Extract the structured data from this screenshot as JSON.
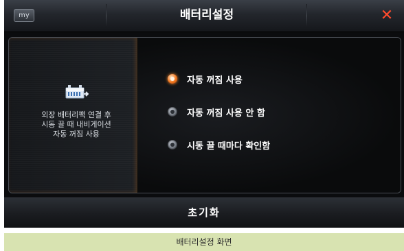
{
  "header": {
    "my_label": "my",
    "title": "배터리설정",
    "close_icon": "close-icon",
    "close_symbol": "✕"
  },
  "info": {
    "icon": "battery-pack-icon",
    "lines": [
      "외장 배터리팩 연결 후",
      "시동 끌 때 내비게이션",
      "자동 꺼짐 사용"
    ]
  },
  "options": [
    {
      "label": "자동 꺼짐 사용",
      "selected": true
    },
    {
      "label": "자동 꺼짐 사용 안 함",
      "selected": false
    },
    {
      "label": "시동 끌 때마다 확인함",
      "selected": false
    }
  ],
  "footer": {
    "reset_label": "초기화"
  },
  "caption": "배터리설정 화면",
  "colors": {
    "accent": "#f2771e",
    "close": "#ff4a2c",
    "caption_bg": "#d8e3b1"
  }
}
